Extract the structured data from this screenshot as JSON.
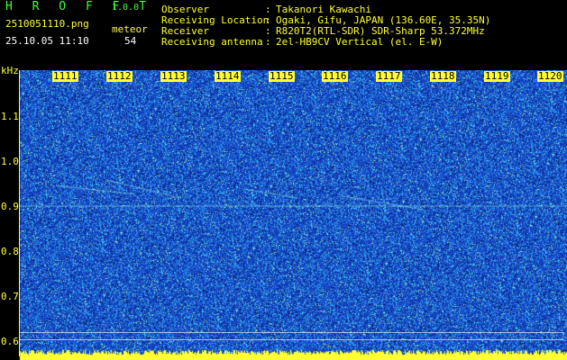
{
  "app": {
    "name": "H R O F F T",
    "version": "1.0.0",
    "filename": "2510051110.png",
    "datetime": "25.10.05 11:10",
    "meteor_label": "meteor",
    "meteor_count": "54"
  },
  "station": [
    {
      "label": "Observer",
      "value": "Takanori Kawachi"
    },
    {
      "label": "Receiving Location",
      "value": "Ogaki, Gifu, JAPAN (136.60E, 35.35N)"
    },
    {
      "label": "Receiver",
      "value": "R820T2(RTL-SDR) SDR-Sharp 53.372MHz"
    },
    {
      "label": "Receiving antenna",
      "value": "2el-HB9CV Vertical (el. E-W)"
    }
  ],
  "y_axis": {
    "unit": "kHz",
    "ticks": [
      "1.1",
      "1.0",
      "0.9",
      "0.8",
      "0.7",
      "0.6"
    ]
  },
  "x_axis": {
    "minutes": [
      "1111",
      "1112",
      "1113",
      "1114",
      "1115",
      "1116",
      "1117",
      "1118",
      "1119",
      "1120"
    ]
  },
  "colors": {
    "label_yellow": "#ffff33",
    "title_green": "#3cff3c",
    "noise_blue": "#1e4fd0",
    "trace_cyan": "#8ff5ff"
  }
}
